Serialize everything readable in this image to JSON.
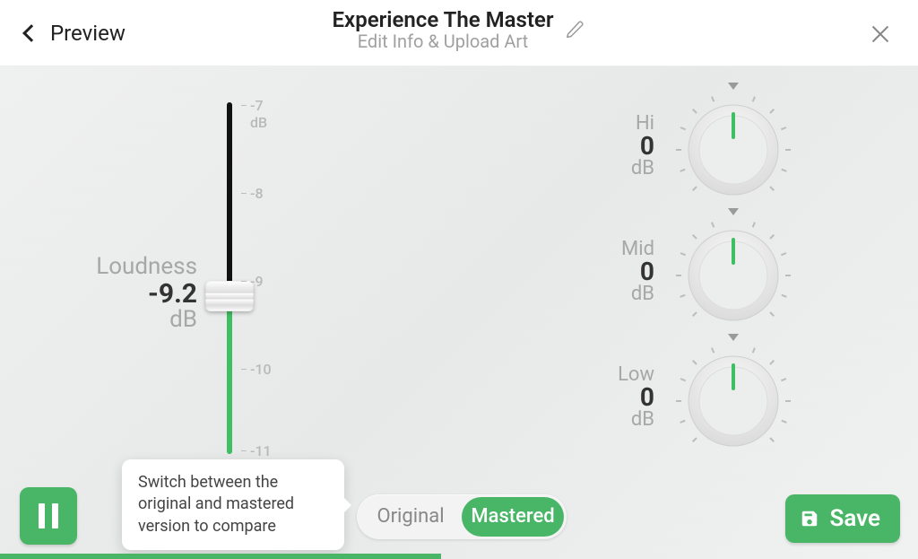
{
  "header": {
    "back_label": "Preview",
    "title": "Experience The Master",
    "subtitle": "Edit Info & Upload Art"
  },
  "loudness": {
    "label": "Loudness",
    "value": "-9.2",
    "unit": "dB",
    "ticks": [
      "-7",
      "-8",
      "-9",
      "-10",
      "-11"
    ],
    "tick_unit": "dB"
  },
  "eq": [
    {
      "band": "Hi",
      "value": "0",
      "unit": "dB"
    },
    {
      "band": "Mid",
      "value": "0",
      "unit": "dB"
    },
    {
      "band": "Low",
      "value": "0",
      "unit": "dB"
    }
  ],
  "tooltip": "Switch between the original and mastered version to compare",
  "toggle": {
    "option_a": "Original",
    "option_b": "Mastered",
    "active": "b"
  },
  "save_label": "Save",
  "colors": {
    "accent": "#49b667"
  },
  "progress_fraction": 0.48
}
